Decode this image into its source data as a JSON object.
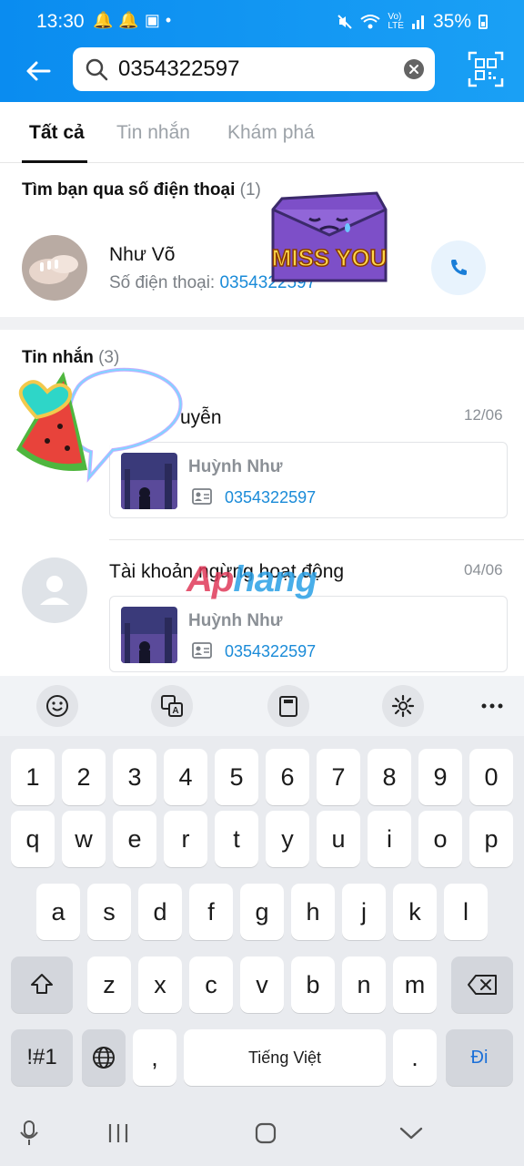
{
  "status_bar": {
    "time": "13:30",
    "battery": "35%"
  },
  "search": {
    "value": "0354322597"
  },
  "tabs": [
    {
      "label": "Tất cả",
      "active": true
    },
    {
      "label": "Tin nhắn",
      "active": false
    },
    {
      "label": "Khám phá",
      "active": false
    }
  ],
  "phone_section": {
    "title": "Tìm bạn qua số điện thoại",
    "count": "(1)",
    "contact": {
      "name": "Như Võ",
      "phone_label": "Số điện thoại:",
      "phone": "0354322597"
    }
  },
  "messages_section": {
    "title": "Tin nhắn",
    "count": "(3)",
    "items": [
      {
        "title": "uyễn",
        "date": "12/06",
        "card_name": "Huỳnh Như",
        "card_phone": "0354322597"
      },
      {
        "title": "Tài khoản ngừng hoạt động",
        "date": "04/06",
        "card_name": "Huỳnh Như",
        "card_phone": "0354322597"
      }
    ]
  },
  "stickers": {
    "miss_you": "MISS YOU"
  },
  "watermark": {
    "part1": "Ap",
    "part2": "hang"
  },
  "keyboard": {
    "row_numbers": [
      "1",
      "2",
      "3",
      "4",
      "5",
      "6",
      "7",
      "8",
      "9",
      "0"
    ],
    "row1": [
      "q",
      "w",
      "e",
      "r",
      "t",
      "y",
      "u",
      "i",
      "o",
      "p"
    ],
    "row2": [
      "a",
      "s",
      "d",
      "f",
      "g",
      "h",
      "j",
      "k",
      "l"
    ],
    "row3": [
      "z",
      "x",
      "c",
      "v",
      "b",
      "n",
      "m"
    ],
    "symbols_label": "!#1",
    "comma": ",",
    "space_label": "Tiếng Việt",
    "period": ".",
    "go_label": "Đi"
  },
  "colors": {
    "header": "#0a8cf0",
    "link": "#1a8bd8"
  }
}
